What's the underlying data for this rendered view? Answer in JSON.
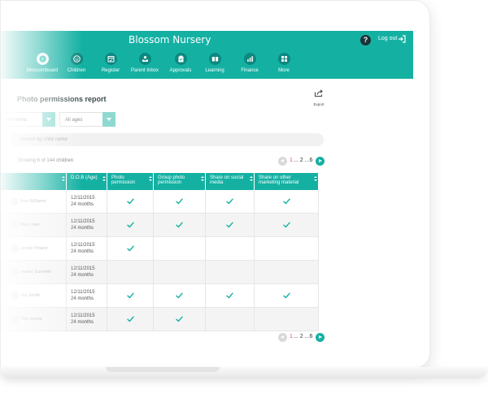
{
  "app": {
    "title": "Blossom Nursery",
    "help_label": "?",
    "logout_label": "Log out"
  },
  "nav": [
    {
      "label": "Blossomboard",
      "icon": "blossom-logo-icon"
    },
    {
      "label": "Children",
      "icon": "smiley-icon"
    },
    {
      "label": "Register",
      "icon": "register-icon"
    },
    {
      "label": "Parent Inbox",
      "icon": "inbox-icon"
    },
    {
      "label": "Approvals",
      "icon": "clipboard-check-icon"
    },
    {
      "label": "Learning",
      "icon": "book-icon"
    },
    {
      "label": "Finance",
      "icon": "bar-chart-icon"
    },
    {
      "label": "More",
      "icon": "grid-icon"
    }
  ],
  "page": {
    "title": "Photo permissions report",
    "export_label": "Export"
  },
  "filters": {
    "room_value": "All rooms",
    "age_value": "All ages"
  },
  "search": {
    "placeholder": "Search by child name"
  },
  "count_label": "Showing 6 of 144 children",
  "pagination": {
    "current": "1",
    "rest": "... 2 ...6"
  },
  "table": {
    "headers": [
      "",
      "D.O.B (Age)",
      "Photo permission",
      "Group photo permission",
      "Share on social media",
      "Share on other marketing material"
    ],
    "rows": [
      {
        "name": "Ava Williams",
        "dob": "12/11/2015",
        "age": "24 months",
        "photo": true,
        "group": true,
        "social": true,
        "marketing": true
      },
      {
        "name": "Mia Lowe",
        "dob": "12/11/2015",
        "age": "24 months",
        "photo": true,
        "group": true,
        "social": true,
        "marketing": true
      },
      {
        "name": "Jessie Pinard",
        "dob": "12/11/2015",
        "age": "24 months",
        "photo": true,
        "group": false,
        "social": false,
        "marketing": false
      },
      {
        "name": "Harley Summer",
        "dob": "12/11/2015",
        "age": "24 months",
        "photo": false,
        "group": false,
        "social": false,
        "marketing": false
      },
      {
        "name": "Jos Smith",
        "dob": "12/11/2015",
        "age": "24 months",
        "photo": true,
        "group": true,
        "social": true,
        "marketing": true
      },
      {
        "name": "Tom Jones",
        "dob": "12/11/2015",
        "age": "24 months",
        "photo": true,
        "group": true,
        "social": false,
        "marketing": false
      }
    ]
  },
  "colors": {
    "teal": "#14b1a3",
    "check": "#14b1a3",
    "page_number": "#e0506a"
  }
}
